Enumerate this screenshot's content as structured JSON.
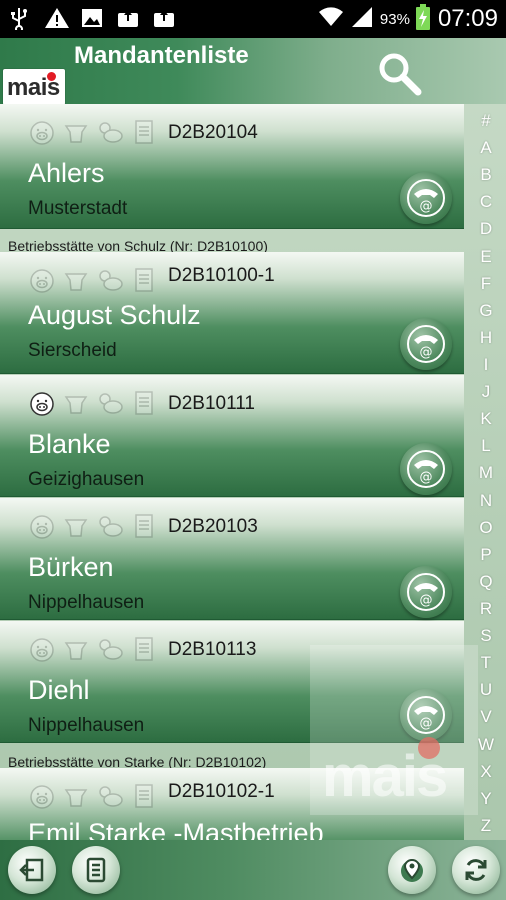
{
  "status_bar": {
    "battery": "93%",
    "time": "07:09",
    "icons": [
      "usb-icon",
      "warning-icon",
      "image-icon",
      "briefcase-upload-icon",
      "briefcase-upload-icon",
      "wifi-icon",
      "signal-icon",
      "battery-charging-icon"
    ]
  },
  "header": {
    "logo_text": "mais",
    "title": "Mandantenliste",
    "search_icon": "search-icon"
  },
  "colors": {
    "header_green": "#2f7a4a",
    "card_dark_green": "#2d6d41",
    "logo_red": "#e21b24"
  },
  "clients": [
    {
      "code": "D2B20104",
      "name": "Ahlers",
      "city": "Musterstadt",
      "section_label": "",
      "icons": [
        "pig-icon",
        "cattle-icon",
        "poultry-icon",
        "document-icon"
      ],
      "active_icon": ""
    },
    {
      "code": "D2B10100-1",
      "name": "August Schulz",
      "city": "Sierscheid",
      "section_label": "Betriebsstätte von Schulz (Nr: D2B10100)",
      "icons": [
        "pig-icon",
        "cattle-icon",
        "poultry-icon",
        "document-icon"
      ],
      "active_icon": ""
    },
    {
      "code": "D2B10111",
      "name": "Blanke",
      "city": "Geizighausen",
      "section_label": "",
      "icons": [
        "pig-icon",
        "cattle-icon",
        "poultry-icon",
        "document-icon"
      ],
      "active_icon": "pig-icon"
    },
    {
      "code": "D2B20103",
      "name": "Bürken",
      "city": "Nippelhausen",
      "section_label": "",
      "icons": [
        "pig-icon",
        "cattle-icon",
        "poultry-icon",
        "document-icon"
      ],
      "active_icon": ""
    },
    {
      "code": "D2B10113",
      "name": "Diehl",
      "city": "Nippelhausen",
      "section_label": "",
      "icons": [
        "pig-icon",
        "cattle-icon",
        "poultry-icon",
        "document-icon"
      ],
      "active_icon": ""
    },
    {
      "code": "D2B10102-1",
      "name": "Emil Starke -Mastbetrieb",
      "city": "",
      "section_label": "Betriebsstätte von Starke (Nr: D2B10102)",
      "icons": [
        "pig-icon",
        "cattle-icon",
        "poultry-icon",
        "document-icon"
      ],
      "active_icon": ""
    }
  ],
  "alphabet": [
    "#",
    "A",
    "B",
    "C",
    "D",
    "E",
    "F",
    "G",
    "H",
    "I",
    "J",
    "K",
    "L",
    "M",
    "N",
    "O",
    "P",
    "Q",
    "R",
    "S",
    "T",
    "U",
    "V",
    "W",
    "X",
    "Y",
    "Z"
  ],
  "watermark": {
    "text": "mais"
  },
  "bottom_bar": {
    "buttons": [
      "exit-icon",
      "notes-icon",
      "map-pin-icon",
      "sync-icon"
    ]
  }
}
